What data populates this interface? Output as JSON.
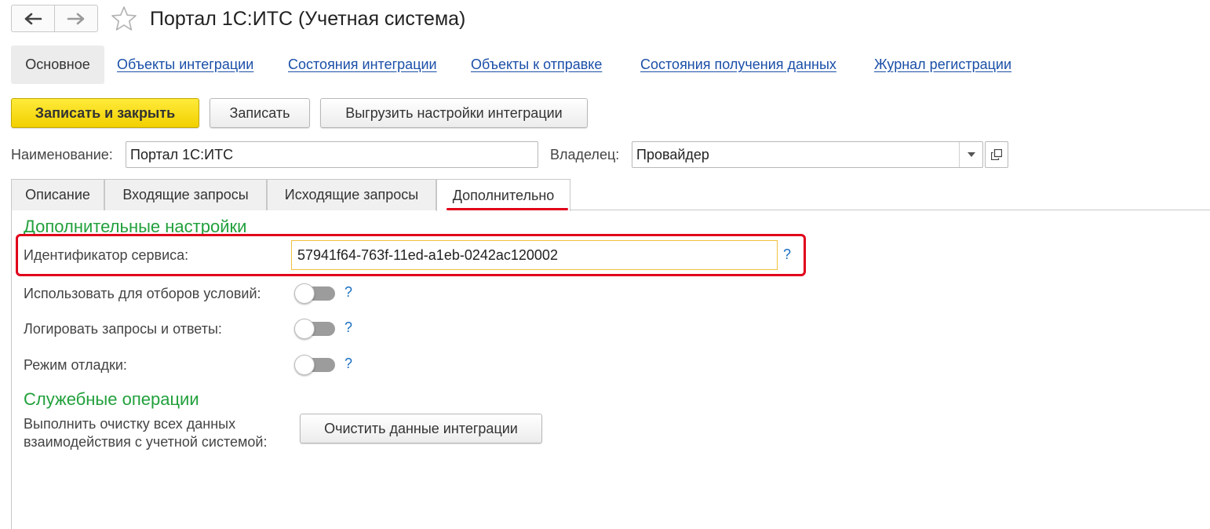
{
  "header": {
    "title": "Портал 1С:ИТС (Учетная система)",
    "back_icon": "arrow-left-icon",
    "forward_icon": "arrow-right-icon",
    "favorite_icon": "star-icon"
  },
  "panel": {
    "active": "Основное",
    "links": [
      "Объекты интеграции",
      "Состояния интеграции",
      "Объекты к отправке",
      "Состояния получения данных",
      "Журнал регистрации"
    ]
  },
  "toolbar": {
    "save_close": "Записать и закрыть",
    "save": "Записать",
    "export": "Выгрузить настройки интеграции"
  },
  "form": {
    "name_label": "Наименование:",
    "name_value": "Портал 1С:ИТС",
    "owner_label": "Владелец:",
    "owner_value": "Провайдер"
  },
  "tabs": [
    "Описание",
    "Входящие запросы",
    "Исходящие запросы",
    "Дополнительно"
  ],
  "additional": {
    "section_title": "Дополнительные настройки",
    "service_id_label": "Идентификатор сервиса:",
    "service_id_value": "57941f64-763f-11ed-a1eb-0242ac120002",
    "help_mark": "?",
    "toggles": [
      {
        "label": "Использовать для отборов условий:",
        "on": false
      },
      {
        "label": "Логировать запросы и ответы:",
        "on": false
      },
      {
        "label": "Режим отладки:",
        "on": false
      }
    ]
  },
  "service": {
    "section_title": "Служебные операции",
    "description_line1": "Выполнить очистку всех данных",
    "description_line2": "взаимодействия с учетной системой:",
    "clear_button": "Очистить данные интеграции"
  },
  "colors": {
    "accent_yellow": "#f2d000",
    "link_blue": "#1b4fa8",
    "section_green": "#22a03c",
    "highlight_red": "#e0001b"
  }
}
